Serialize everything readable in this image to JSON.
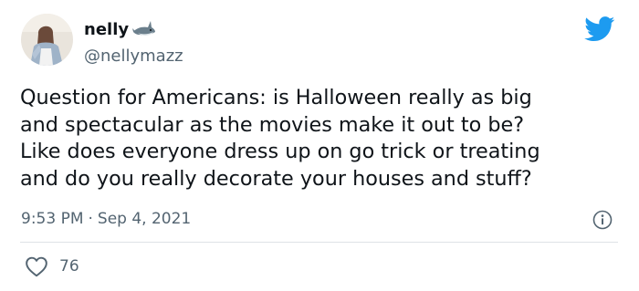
{
  "author": {
    "display_name": "nelly",
    "handle": "@nellymazz",
    "badge_icon": "shark-icon",
    "avatar_icon": "profile-photo"
  },
  "tweet": {
    "lines": [
      "Question for Americans: is Halloween really as big",
      "and spectacular as the movies make it out to be?",
      "Like does everyone dress up on go trick or treating",
      "and do you really decorate your houses and stuff?"
    ],
    "time": "9:53 PM",
    "separator": "·",
    "date": "Sep 4, 2021"
  },
  "engagement": {
    "likes": "76",
    "like_icon": "heart-icon"
  },
  "brand": {
    "icon": "twitter-bird-icon",
    "color": "#1d9bf0"
  },
  "colors": {
    "text": "#0f1419",
    "secondary_text": "#536471",
    "divider": "#dfe3e6"
  }
}
